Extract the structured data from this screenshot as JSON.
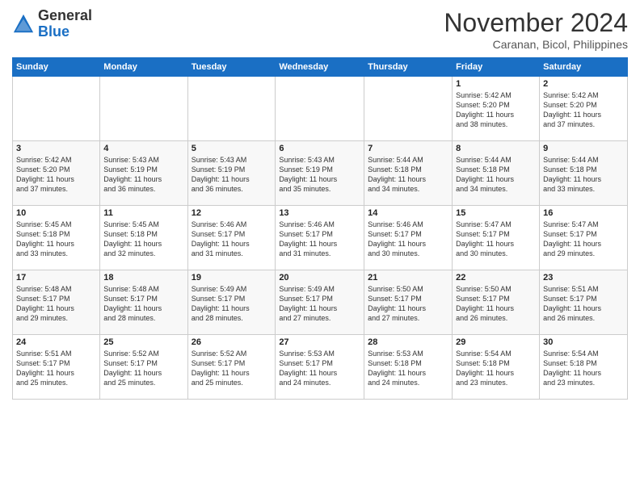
{
  "header": {
    "logo_general": "General",
    "logo_blue": "Blue",
    "month_title": "November 2024",
    "subtitle": "Caranan, Bicol, Philippines"
  },
  "days_of_week": [
    "Sunday",
    "Monday",
    "Tuesday",
    "Wednesday",
    "Thursday",
    "Friday",
    "Saturday"
  ],
  "weeks": [
    [
      {
        "day": "",
        "info": ""
      },
      {
        "day": "",
        "info": ""
      },
      {
        "day": "",
        "info": ""
      },
      {
        "day": "",
        "info": ""
      },
      {
        "day": "",
        "info": ""
      },
      {
        "day": "1",
        "info": "Sunrise: 5:42 AM\nSunset: 5:20 PM\nDaylight: 11 hours\nand 38 minutes."
      },
      {
        "day": "2",
        "info": "Sunrise: 5:42 AM\nSunset: 5:20 PM\nDaylight: 11 hours\nand 37 minutes."
      }
    ],
    [
      {
        "day": "3",
        "info": "Sunrise: 5:42 AM\nSunset: 5:20 PM\nDaylight: 11 hours\nand 37 minutes."
      },
      {
        "day": "4",
        "info": "Sunrise: 5:43 AM\nSunset: 5:19 PM\nDaylight: 11 hours\nand 36 minutes."
      },
      {
        "day": "5",
        "info": "Sunrise: 5:43 AM\nSunset: 5:19 PM\nDaylight: 11 hours\nand 36 minutes."
      },
      {
        "day": "6",
        "info": "Sunrise: 5:43 AM\nSunset: 5:19 PM\nDaylight: 11 hours\nand 35 minutes."
      },
      {
        "day": "7",
        "info": "Sunrise: 5:44 AM\nSunset: 5:18 PM\nDaylight: 11 hours\nand 34 minutes."
      },
      {
        "day": "8",
        "info": "Sunrise: 5:44 AM\nSunset: 5:18 PM\nDaylight: 11 hours\nand 34 minutes."
      },
      {
        "day": "9",
        "info": "Sunrise: 5:44 AM\nSunset: 5:18 PM\nDaylight: 11 hours\nand 33 minutes."
      }
    ],
    [
      {
        "day": "10",
        "info": "Sunrise: 5:45 AM\nSunset: 5:18 PM\nDaylight: 11 hours\nand 33 minutes."
      },
      {
        "day": "11",
        "info": "Sunrise: 5:45 AM\nSunset: 5:18 PM\nDaylight: 11 hours\nand 32 minutes."
      },
      {
        "day": "12",
        "info": "Sunrise: 5:46 AM\nSunset: 5:17 PM\nDaylight: 11 hours\nand 31 minutes."
      },
      {
        "day": "13",
        "info": "Sunrise: 5:46 AM\nSunset: 5:17 PM\nDaylight: 11 hours\nand 31 minutes."
      },
      {
        "day": "14",
        "info": "Sunrise: 5:46 AM\nSunset: 5:17 PM\nDaylight: 11 hours\nand 30 minutes."
      },
      {
        "day": "15",
        "info": "Sunrise: 5:47 AM\nSunset: 5:17 PM\nDaylight: 11 hours\nand 30 minutes."
      },
      {
        "day": "16",
        "info": "Sunrise: 5:47 AM\nSunset: 5:17 PM\nDaylight: 11 hours\nand 29 minutes."
      }
    ],
    [
      {
        "day": "17",
        "info": "Sunrise: 5:48 AM\nSunset: 5:17 PM\nDaylight: 11 hours\nand 29 minutes."
      },
      {
        "day": "18",
        "info": "Sunrise: 5:48 AM\nSunset: 5:17 PM\nDaylight: 11 hours\nand 28 minutes."
      },
      {
        "day": "19",
        "info": "Sunrise: 5:49 AM\nSunset: 5:17 PM\nDaylight: 11 hours\nand 28 minutes."
      },
      {
        "day": "20",
        "info": "Sunrise: 5:49 AM\nSunset: 5:17 PM\nDaylight: 11 hours\nand 27 minutes."
      },
      {
        "day": "21",
        "info": "Sunrise: 5:50 AM\nSunset: 5:17 PM\nDaylight: 11 hours\nand 27 minutes."
      },
      {
        "day": "22",
        "info": "Sunrise: 5:50 AM\nSunset: 5:17 PM\nDaylight: 11 hours\nand 26 minutes."
      },
      {
        "day": "23",
        "info": "Sunrise: 5:51 AM\nSunset: 5:17 PM\nDaylight: 11 hours\nand 26 minutes."
      }
    ],
    [
      {
        "day": "24",
        "info": "Sunrise: 5:51 AM\nSunset: 5:17 PM\nDaylight: 11 hours\nand 25 minutes."
      },
      {
        "day": "25",
        "info": "Sunrise: 5:52 AM\nSunset: 5:17 PM\nDaylight: 11 hours\nand 25 minutes."
      },
      {
        "day": "26",
        "info": "Sunrise: 5:52 AM\nSunset: 5:17 PM\nDaylight: 11 hours\nand 25 minutes."
      },
      {
        "day": "27",
        "info": "Sunrise: 5:53 AM\nSunset: 5:17 PM\nDaylight: 11 hours\nand 24 minutes."
      },
      {
        "day": "28",
        "info": "Sunrise: 5:53 AM\nSunset: 5:18 PM\nDaylight: 11 hours\nand 24 minutes."
      },
      {
        "day": "29",
        "info": "Sunrise: 5:54 AM\nSunset: 5:18 PM\nDaylight: 11 hours\nand 23 minutes."
      },
      {
        "day": "30",
        "info": "Sunrise: 5:54 AM\nSunset: 5:18 PM\nDaylight: 11 hours\nand 23 minutes."
      }
    ]
  ]
}
